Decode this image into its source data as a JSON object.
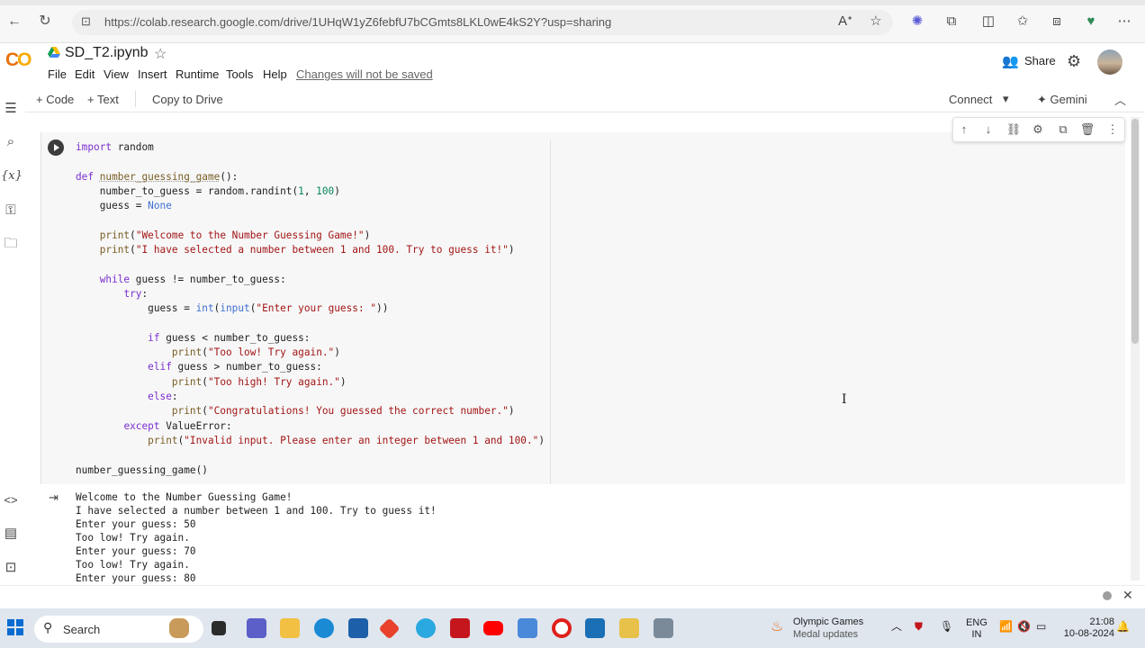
{
  "browser": {
    "url": "https://colab.research.google.com/drive/1UHqW1yZ6febfU7bCGmts8LKL0wE4kS2Y?usp=sharing"
  },
  "colab": {
    "logo": "CO",
    "notebook_title": "SD_T2.ipynb",
    "menu": [
      "File",
      "Edit",
      "View",
      "Insert",
      "Runtime",
      "Tools",
      "Help"
    ],
    "changes_notice": "Changes will not be saved",
    "share_label": "Share"
  },
  "toolbar": {
    "add_code": "+ Code",
    "add_text": "+ Text",
    "copy_to_drive": "Copy to Drive",
    "connect": "Connect",
    "gemini": "Gemini"
  },
  "code_lines": [
    "import random",
    "",
    "def number_guessing_game():",
    "    number_to_guess = random.randint(1, 100)",
    "    guess = None",
    "",
    "    print(\"Welcome to the Number Guessing Game!\")",
    "    print(\"I have selected a number between 1 and 100. Try to guess it!\")",
    "",
    "    while guess != number_to_guess:",
    "        try:",
    "            guess = int(input(\"Enter your guess: \"))",
    "",
    "            if guess < number_to_guess:",
    "                print(\"Too low! Try again.\")",
    "            elif guess > number_to_guess:",
    "                print(\"Too high! Try again.\")",
    "            else:",
    "                print(\"Congratulations! You guessed the correct number.\")",
    "        except ValueError:",
    "            print(\"Invalid input. Please enter an integer between 1 and 100.\")",
    "",
    "number_guessing_game()"
  ],
  "output_lines": [
    "Welcome to the Number Guessing Game!",
    "I have selected a number between 1 and 100. Try to guess it!",
    "Enter your guess: 50",
    "Too low! Try again.",
    "Enter your guess: 70",
    "Too low! Try again.",
    "Enter your guess: 80"
  ],
  "taskbar": {
    "search_label": "Search",
    "news_title": "Olympic Games",
    "news_subtitle": "Medal updates",
    "lang_line1": "ENG",
    "lang_line2": "IN",
    "time": "21:08",
    "date": "10-08-2024"
  },
  "colors": {
    "accent_orange": "#f9ab00",
    "keyword": "#7b30d0",
    "string": "#a31515",
    "number": "#098658",
    "taskbar_bg": "#dfe6ee"
  }
}
